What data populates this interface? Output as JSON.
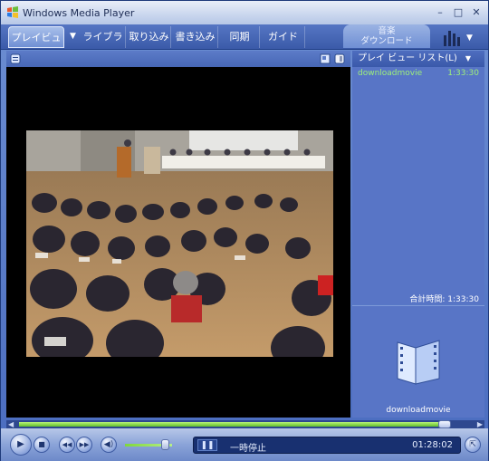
{
  "window": {
    "title": "Windows Media Player"
  },
  "tabs": [
    {
      "label": "プレイビュー"
    },
    {
      "label": "ライブラリ"
    },
    {
      "label": "取り込み"
    },
    {
      "label": "書き込み"
    },
    {
      "label": "同期"
    },
    {
      "label": "ガイド"
    }
  ],
  "music_tab": {
    "line1": "音楽",
    "line2": "ダウンロード"
  },
  "playlist": {
    "header": "プレイ ビュー リスト(L)",
    "items": [
      {
        "title": "downloadmovie",
        "duration": "1:33:30"
      }
    ],
    "total": "合計時間: 1:33:30",
    "art_label": "downloadmovie"
  },
  "player": {
    "status": "一時停止",
    "time": "01:28:02",
    "progress": 0.94,
    "volume": 0.85
  },
  "colors": {
    "accent": "#4a6cbf",
    "progress": "#7fd83c",
    "playlist_text": "#9ef07a"
  }
}
